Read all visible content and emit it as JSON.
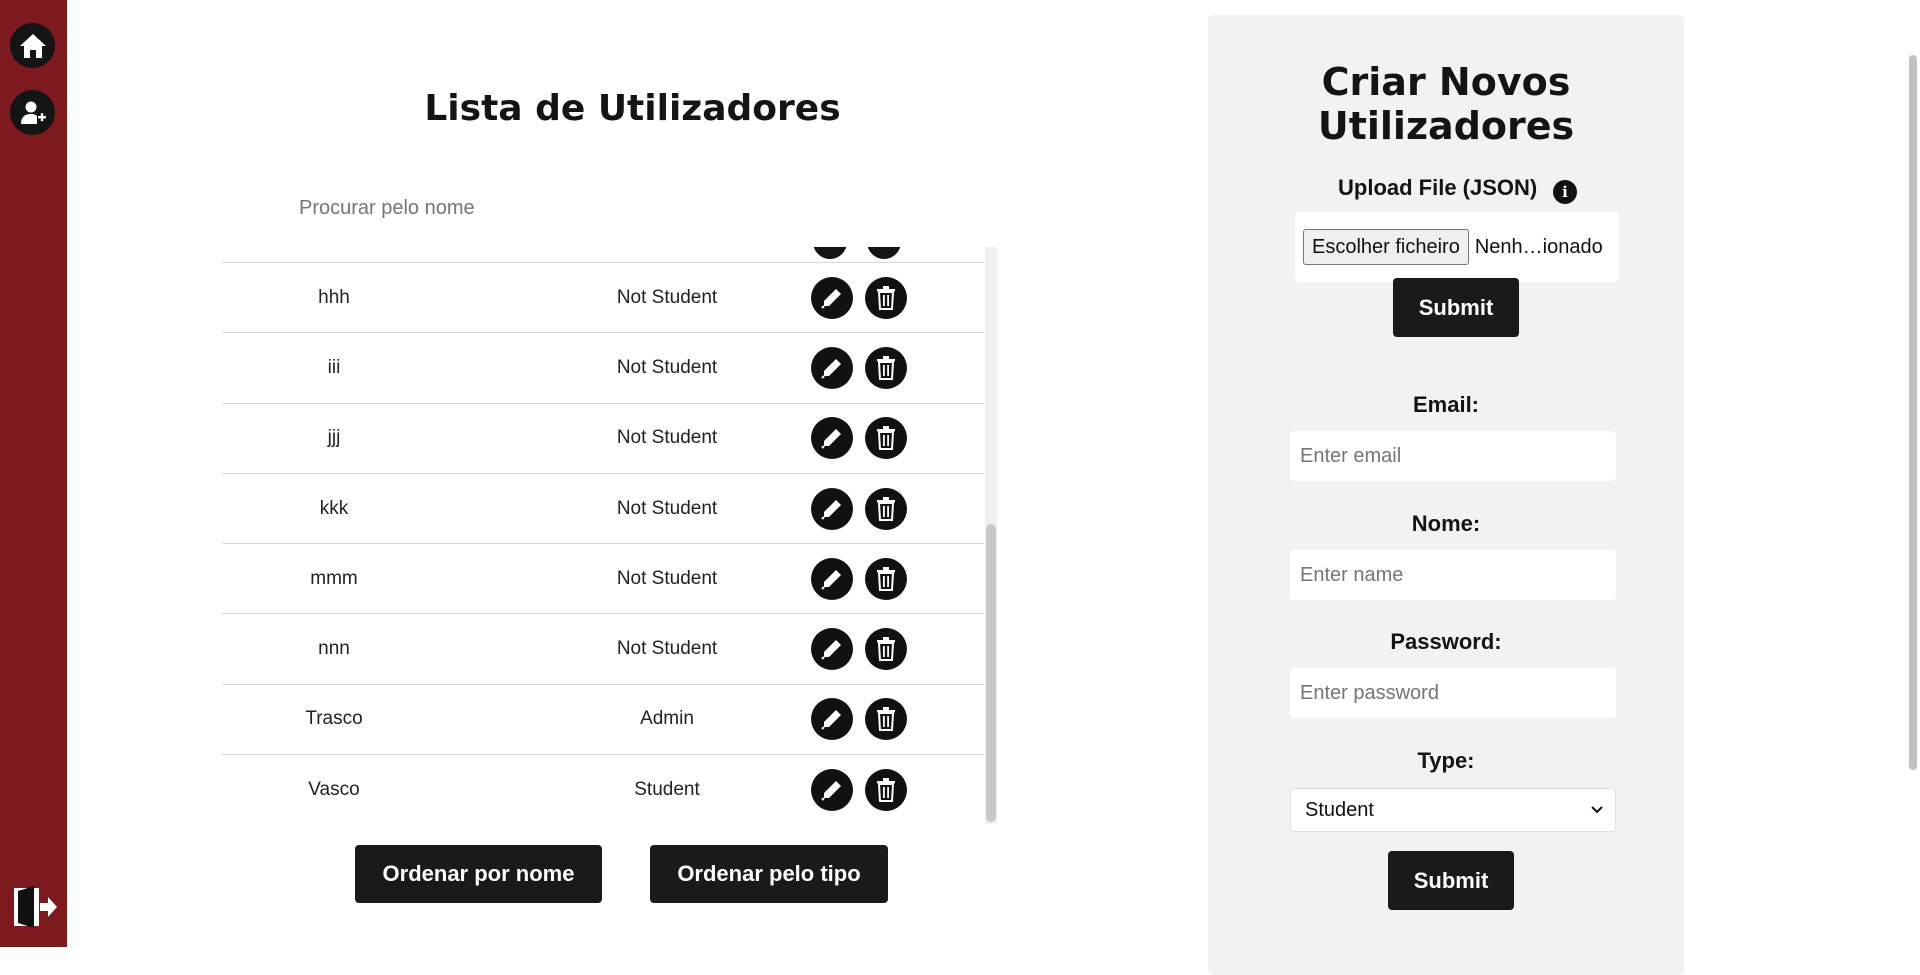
{
  "sidebar": {
    "items": [
      {
        "name": "home-icon"
      },
      {
        "name": "add-user-icon"
      }
    ],
    "logout_icon": "logout-icon",
    "color": "#7d1a1f"
  },
  "user_list": {
    "title": "Lista de Utilizadores",
    "search_placeholder": "Procurar pelo nome",
    "rows": [
      {
        "name": "hhh",
        "type": "Not Student"
      },
      {
        "name": "iii",
        "type": "Not Student"
      },
      {
        "name": "jjj",
        "type": "Not Student"
      },
      {
        "name": "kkk",
        "type": "Not Student"
      },
      {
        "name": "mmm",
        "type": "Not Student"
      },
      {
        "name": "nnn",
        "type": "Not Student"
      },
      {
        "name": "Trasco",
        "type": "Admin"
      },
      {
        "name": "Vasco",
        "type": "Student"
      }
    ],
    "row_actions": [
      "edit-icon",
      "delete-icon"
    ],
    "sort_by_name_label": "Ordenar por nome",
    "sort_by_type_label": "Ordenar pelo tipo"
  },
  "create_form": {
    "title": "Criar Novos Utilizadores",
    "upload_label": "Upload File (JSON)",
    "info_icon": "i",
    "file_button_label": "Escolher ficheiro",
    "file_status": "Nenh…ionado",
    "upload_submit_label": "Submit",
    "email_label": "Email:",
    "email_placeholder": "Enter email",
    "name_label": "Nome:",
    "name_placeholder": "Enter name",
    "password_label": "Password:",
    "password_placeholder": "Enter password",
    "type_label": "Type:",
    "type_selected": "Student",
    "form_submit_label": "Submit"
  }
}
